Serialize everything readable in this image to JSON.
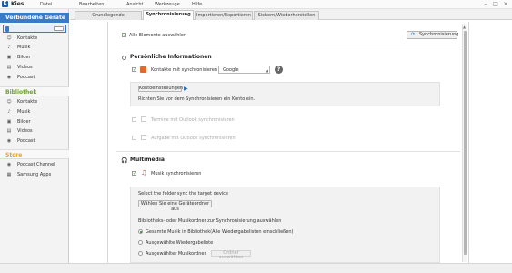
{
  "app": {
    "title": "Kies"
  },
  "menu": [
    "Datei",
    "Bearbeiten",
    "Ansicht",
    "Werkzeuge",
    "Hilfe"
  ],
  "tabs": [
    "Grundlegende Informationen",
    "Synchronisierung",
    "Importieren/Exportieren",
    "Sichern/Wiederherstellen"
  ],
  "sidebar": {
    "devices": {
      "title": "Verbundene Geräte",
      "items": [
        "Kontakte",
        "Musik",
        "Bilder",
        "Videos",
        "Podcast"
      ]
    },
    "library": {
      "title": "Bibliothek",
      "items": [
        "Kontakte",
        "Musik",
        "Bilder",
        "Videos",
        "Podcast"
      ]
    },
    "store": {
      "title": "Store",
      "items": [
        "Podcast Channel",
        "Samsung Apps"
      ]
    }
  },
  "sync": {
    "select_all": "Alle Elemente auswählen",
    "sync_button": "Synchronisierung",
    "personal": {
      "title": "Persönliche Informationen",
      "contacts_label": "Kontakte mit synchronisieren",
      "contacts_account": "Google",
      "account_settings_button": "Kontoeinstellungen",
      "account_hint": "Richten Sie vor dem Synchronisieren ein Konto ein.",
      "calendar_label": "Termine mit Outlook synchronisieren",
      "tasks_label": "Aufgabe mit Outlook synchronisieren"
    },
    "multimedia": {
      "title": "Multimedia",
      "music_label": "Musik synchronisieren",
      "folder_prompt": "Select the folder sync the target device",
      "choose_folder_button": "Wählen Sie eine Geräteordner aus",
      "library_prompt": "Bibliotheks- oder Musikordner zur Synchronisierung auswählen",
      "options": [
        "Gesamte Musik in Bibliothek(Alle Wiedergabelisten einschließen)",
        "Ausgewählte Wiedergabeliste",
        "Ausgewählter Musikordner"
      ],
      "folder_select_button": "Ordner auswählen"
    }
  },
  "colors": {
    "devices_header": "#3a7bc8",
    "library_header": "#6aa128",
    "store_header": "#e8a020",
    "checkmark": "#2d8a2d"
  }
}
